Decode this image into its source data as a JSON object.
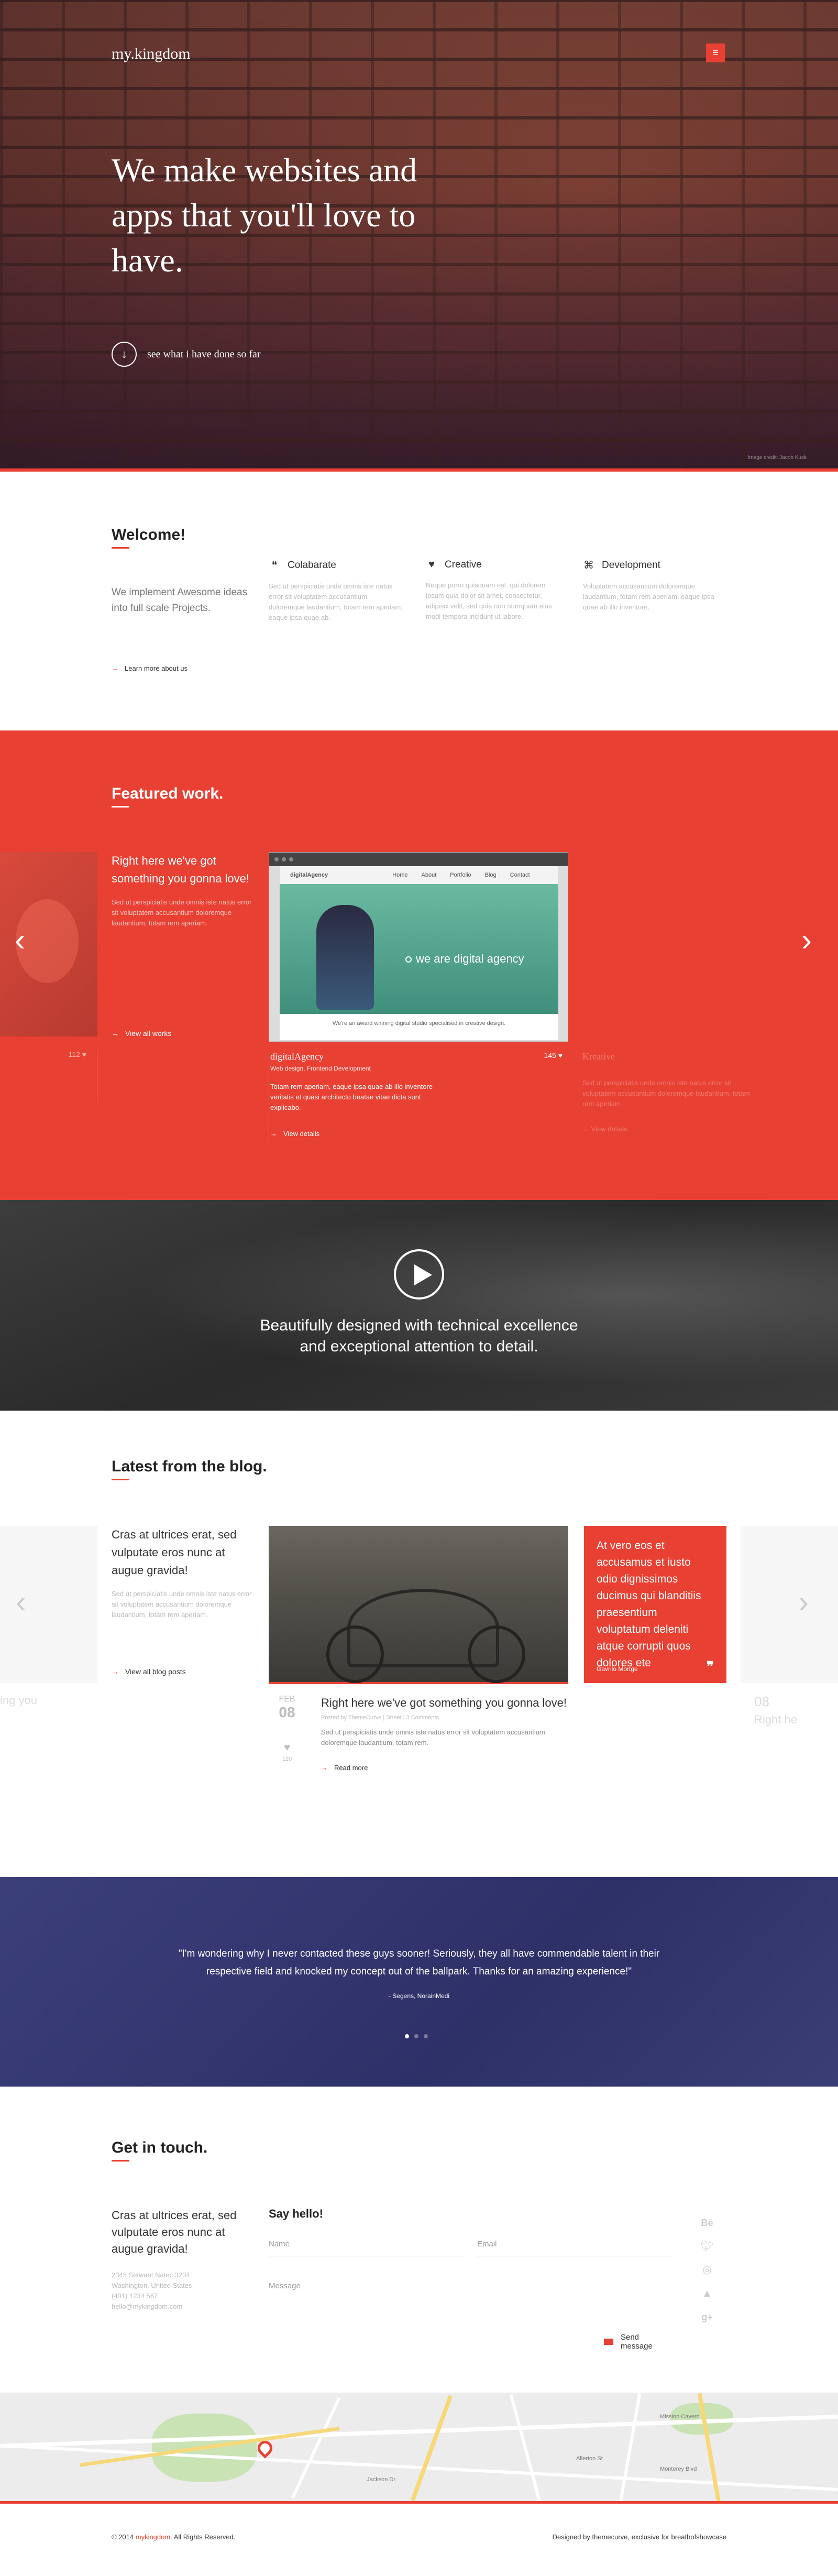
{
  "hero": {
    "logo": "my.kingdom",
    "menu_icon": "hamburger-icon",
    "headline": "We make websites and apps that you'll love to have.",
    "cta": "see what i have done so far",
    "photo_credit": "Image credit: Jacob Kusk"
  },
  "welcome": {
    "title": "Welcome!",
    "intro": "We implement Awesome ideas into full scale Projects.",
    "learn_more": "Learn more about us",
    "features": [
      {
        "icon": "collaborate-icon",
        "title": "Colabarate",
        "text": "Sed ut perspiciatis unde omnis iste natus error sit voluptatem accusantium doloremque laudantium, totam rem aperiam, eaque ipsa quae ab."
      },
      {
        "icon": "heart-icon",
        "title": "Creative",
        "text": "Neque porro quisquam est, qui dolorem ipsum quia dolor sit amet, consectetur, adipisci velit, sed quia non numquam eius modi tempora incidunt ut labore."
      },
      {
        "icon": "command-icon",
        "title": "Development",
        "text": "Voluptatem accusantium doloremque laudantium, totam rem aperiam, eaque ipsa quae ab illo inventore."
      }
    ]
  },
  "featured": {
    "title": "Featured work.",
    "intro": "Right here we've got something you gonna love!",
    "text": "Sed ut perspiciatis unde omnis iste natus error sit voluptatem accusantium doloremque laudantium, totam rem aperiam.",
    "view_all": "View all works",
    "left_likes": "112",
    "screenshot": {
      "brand": "digitalAgency",
      "nav": [
        "Home",
        "About",
        "Portfolio",
        "Blog",
        "Contact"
      ],
      "banner": "we are digital agency",
      "footer_text": "We're an award winning digital studio specialised in creative design."
    },
    "project": {
      "name": "digitalAgency",
      "tags": "Web design, Frontend Development",
      "likes": "145",
      "text": "Totam rem aperiam, eaque ipsa quae ab illo inventore veritatis et quasi architecto beatae vitae dicta sunt explicabo.",
      "view_details": "View details"
    },
    "ghost": {
      "name": "Kreative",
      "text": "Sed ut perspiciatis unde omnis iste natus error sit voluptatem accusantium doloremque laudantium, totam rem aperiam.",
      "view_details": "View details"
    },
    "prev_icon": "chevron-left-icon",
    "next_icon": "chevron-right-icon"
  },
  "video": {
    "play_icon": "play-icon",
    "caption_line1": "Beautifully designed with technical excellence",
    "caption_line2": "and exceptional attention to detail."
  },
  "blog": {
    "title": "Latest from the blog.",
    "intro": "Cras at ultrices erat, sed vulputate eros nunc at augue gravida!",
    "text": "Sed ut perspiciatis unde omnis iste natus error sit voluptatem accusantium doloremque laudantium, totam rem aperiam.",
    "view_all": "View all blog posts",
    "post": {
      "month": "FEB",
      "day": "08",
      "likes": "120",
      "title": "Right here we've got something you gonna love!",
      "byline": "Posted by ThemeCurve | Street | 3 Comments",
      "excerpt": "Sed ut perspiciatis unde omnis iste natus error sit voluptatem accusantium doloremque laudantium, totam rem.",
      "read_more": "Read more"
    },
    "quote": {
      "text": "At vero eos et accusamus et iusto odio dignissimos ducimus qui blanditiis praesentium voluptatum deleniti atque corrupti quos dolores ete",
      "author": "Gavrilo Mortge"
    },
    "ghost_left": "ing you",
    "ghost_right_title": "Right he",
    "ghost_right_date": "08"
  },
  "testimonial": {
    "quote": "\"I'm wondering why I never contacted these guys sooner! Seriously, they all have commendable talent in their respective field and knocked my concept out of the ballpark. Thanks for an amazing experience!\"",
    "author": "- Segens, NorainMedi"
  },
  "contact": {
    "title": "Get in touch.",
    "intro": "Cras at ultrices erat, sed vulputate eros nunc at augue gravida!",
    "address_line1": "2345 Setwant Natec 3234",
    "address_line2": "Washington, United States",
    "phone": "(401) 1234 567",
    "email": "hello@mykingdom.com",
    "form_title": "Say hello!",
    "name_placeholder": "Name",
    "email_placeholder": "Email",
    "message_placeholder": "Message",
    "send": "Send message",
    "social": [
      "behance-icon",
      "twitter-icon",
      "dribbble-icon",
      "forrst-icon",
      "googleplus-icon"
    ]
  },
  "map": {
    "labels": [
      "Mission Cavern",
      "Allerton St",
      "Monterey Blvd",
      "Jackson Dr"
    ]
  },
  "footer": {
    "copyright_prefix": "© 2014 ",
    "brand": "mykingdom",
    "copyright_suffix": ". All Rights Reserved.",
    "designed": "Designed by themecurve, exclusive for breathofshowcase"
  }
}
